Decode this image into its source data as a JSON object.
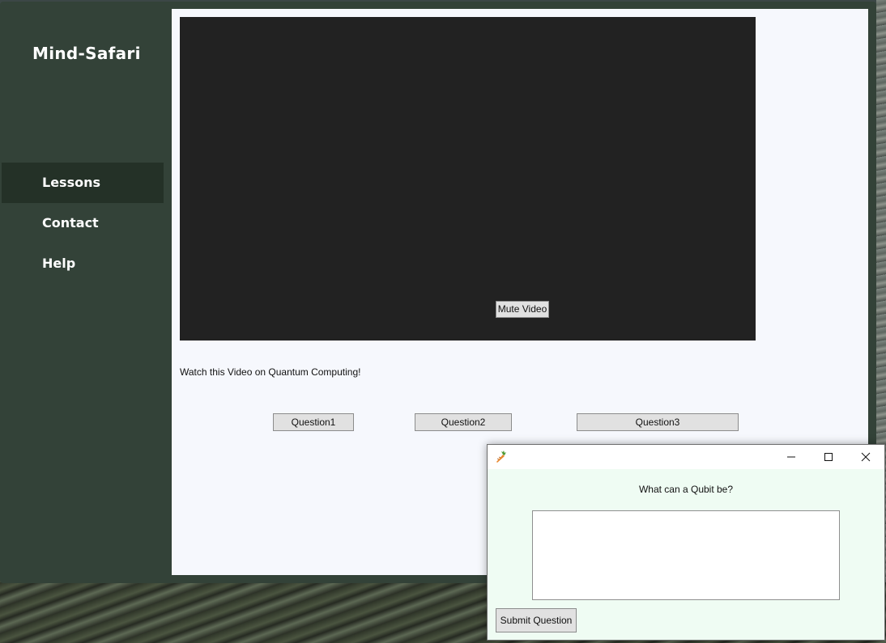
{
  "app": {
    "brand": "Mind-Safari",
    "nav": [
      {
        "label": "Lessons",
        "active": true
      },
      {
        "label": "Contact",
        "active": false
      },
      {
        "label": "Help",
        "active": false
      }
    ]
  },
  "lesson": {
    "mute_label": "Mute Video",
    "caption": "Watch this Video on Quantum Computing!",
    "questions": [
      "Question1",
      "Question2",
      "Question3"
    ]
  },
  "dialog": {
    "prompt": "What can a Qubit be?",
    "answer_value": "",
    "submit_label": "Submit Question",
    "icon": "carrot-app-icon"
  },
  "colors": {
    "sidebar": "#334238",
    "nav_active": "#243127",
    "content_bg": "#f6f8fd",
    "video_bg": "#222222",
    "dialog_bg": "#effcf3"
  }
}
